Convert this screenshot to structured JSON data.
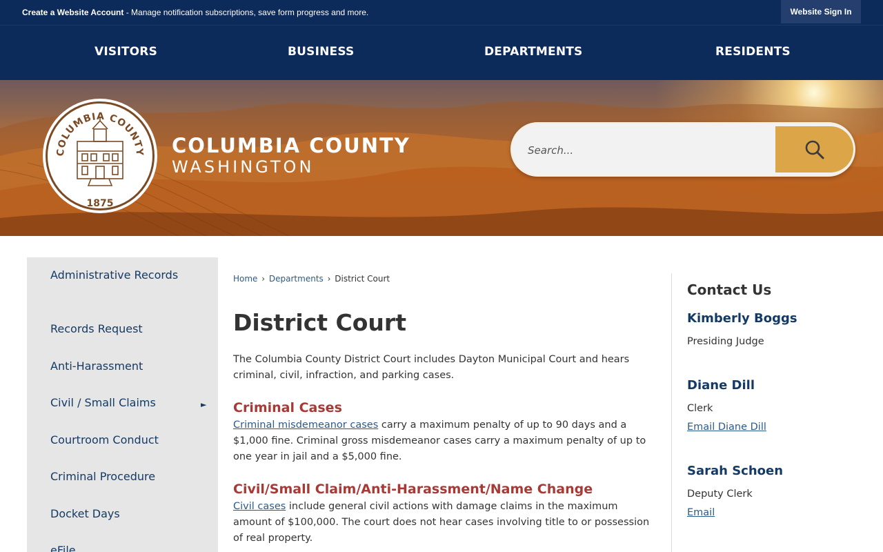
{
  "topbar": {
    "account_bold": "Create a Website Account",
    "account_rest": " - Manage notification subscriptions, save form progress and more.",
    "signin_label": "Website Sign In"
  },
  "nav": {
    "items": [
      "VISITORS",
      "BUSINESS",
      "DEPARTMENTS",
      "RESIDENTS"
    ]
  },
  "brand": {
    "line1": "COLUMBIA COUNTY",
    "line2": "WASHINGTON",
    "seal_text": "COLUMBIA COUNTY",
    "seal_year": "1875"
  },
  "search": {
    "placeholder": "Search..."
  },
  "sidebar": {
    "items": [
      {
        "label": "Administrative Records"
      },
      {
        "label": "Records Request"
      },
      {
        "label": "Anti-Harassment"
      },
      {
        "label": "Civil / Small Claims"
      },
      {
        "label": "Courtroom Conduct"
      },
      {
        "label": "Criminal Procedure"
      },
      {
        "label": "Docket Days"
      },
      {
        "label": "eFile"
      }
    ]
  },
  "breadcrumb": {
    "home": "Home",
    "sep": "›",
    "departments": "Departments",
    "current": "District Court"
  },
  "main": {
    "title": "District Court",
    "intro": "The Columbia County District Court includes Dayton Municipal Court and hears criminal, civil, infraction, and parking cases.",
    "sections": [
      {
        "heading": "Criminal Cases",
        "link": "Criminal misdemeanor cases",
        "text": " carry a maximum penalty of up to 90 days and a $1,000 fine. Criminal gross misdemeanor cases carry a maximum penalty of up to one year in jail and a $5,000 fine."
      },
      {
        "heading": "Civil/Small Claim/Anti-Harassment/Name Change",
        "link": "Civil cases",
        "text": " include general civil actions with damage claims in the maximum amount of $100,000. The court does not hear cases involving title to or possession of real property."
      }
    ]
  },
  "contact": {
    "title": "Contact Us",
    "people": [
      {
        "name": "Kimberly Boggs",
        "role": "Presiding Judge",
        "link": ""
      },
      {
        "name": "Diane Dill",
        "role": "Clerk",
        "link": "Email Diane Dill"
      },
      {
        "name": "Sarah Schoen",
        "role": "Deputy Clerk",
        "link": "Email"
      }
    ]
  },
  "colors": {
    "navy": "#0c2a5a",
    "search_button": "#dca548",
    "heading_red": "#a83a36",
    "link_blue": "#2b5a8c"
  }
}
